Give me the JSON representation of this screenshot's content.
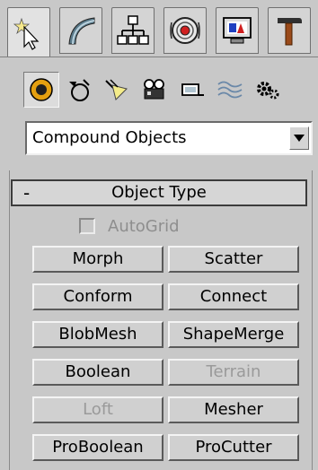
{
  "tabs": [
    {
      "name": "create-tab",
      "icon": "create-star-cursor-icon"
    },
    {
      "name": "modify-tab",
      "icon": "modify-bend-icon"
    },
    {
      "name": "hierarchy-tab",
      "icon": "hierarchy-icon"
    },
    {
      "name": "motion-tab",
      "icon": "motion-icon"
    },
    {
      "name": "display-tab",
      "icon": "display-monitor-icon"
    },
    {
      "name": "utilities-tab",
      "icon": "hammer-icon"
    }
  ],
  "categories": [
    {
      "name": "geometry",
      "icon": "sphere-icon"
    },
    {
      "name": "shapes",
      "icon": "shapes-icon"
    },
    {
      "name": "lights",
      "icon": "light-icon"
    },
    {
      "name": "cameras",
      "icon": "camera-icon"
    },
    {
      "name": "helpers",
      "icon": "helper-tape-icon"
    },
    {
      "name": "space-warps",
      "icon": "space-warp-icon"
    },
    {
      "name": "systems",
      "icon": "systems-gear-icon"
    }
  ],
  "dropdown": {
    "value": "Compound Objects"
  },
  "rollout": {
    "collapse_symbol": "-",
    "title": "Object Type"
  },
  "autogrid": {
    "label": "AutoGrid",
    "checked": false
  },
  "buttons": [
    {
      "label": "Morph",
      "enabled": true
    },
    {
      "label": "Scatter",
      "enabled": true
    },
    {
      "label": "Conform",
      "enabled": true
    },
    {
      "label": "Connect",
      "enabled": true
    },
    {
      "label": "BlobMesh",
      "enabled": true
    },
    {
      "label": "ShapeMerge",
      "enabled": true
    },
    {
      "label": "Boolean",
      "enabled": true
    },
    {
      "label": "Terrain",
      "enabled": false
    },
    {
      "label": "Loft",
      "enabled": false
    },
    {
      "label": "Mesher",
      "enabled": true
    },
    {
      "label": "ProBoolean",
      "enabled": true
    },
    {
      "label": "ProCutter",
      "enabled": true
    }
  ],
  "colors": {
    "panel_bg": "#c8c8c8",
    "active_sphere": "#f0b010",
    "disabled_text": "#9a9a9a"
  }
}
